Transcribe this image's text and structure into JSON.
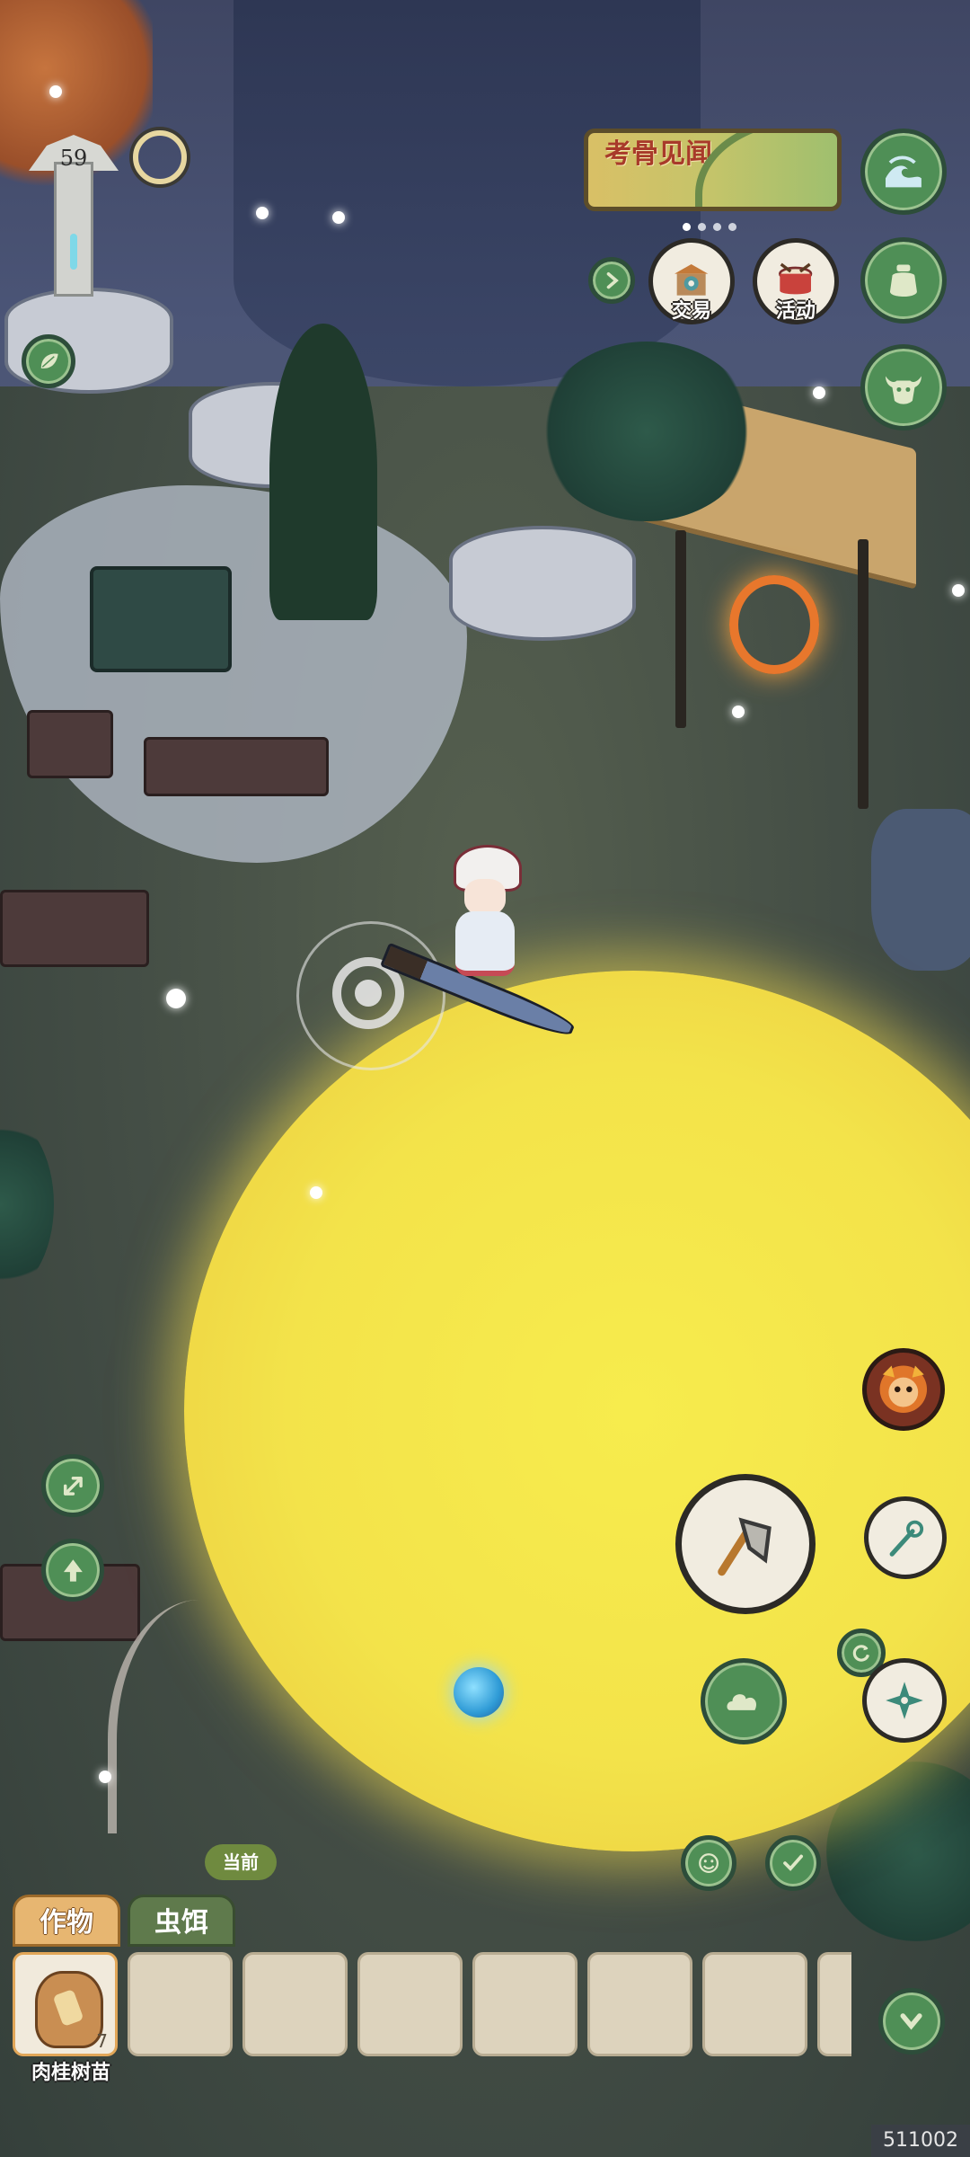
{
  "player_level": "59",
  "banner": {
    "title": "考骨见闻"
  },
  "shortcuts": {
    "trade_label": "交易",
    "event_label": "活动"
  },
  "inventory": {
    "current_tag": "当前",
    "tabs": [
      "作物",
      "虫饵"
    ],
    "slots": [
      {
        "item": "肉桂树苗",
        "count": "7"
      },
      {
        "item": "",
        "count": ""
      },
      {
        "item": "",
        "count": ""
      },
      {
        "item": "",
        "count": ""
      },
      {
        "item": "",
        "count": ""
      },
      {
        "item": "",
        "count": ""
      },
      {
        "item": "",
        "count": ""
      },
      {
        "item": "",
        "count": ""
      }
    ]
  },
  "build_id": "511002",
  "icons": {
    "top_right": [
      "wave-icon",
      "jar-icon",
      "ox-head-icon"
    ],
    "side_right": [
      "monkey-avatar-icon",
      "axe-icon",
      "spear-icon",
      "cloud-icon",
      "refresh-icon",
      "shuriken-icon"
    ],
    "bottom_right": [
      "emote-icon",
      "checklist-icon",
      "collapse-icon"
    ],
    "left": [
      "leaf-icon",
      "expand-icon",
      "tree-icon"
    ]
  },
  "colors": {
    "glow": "#f3e34a",
    "button_green": "#4f8f56",
    "tab_active": "#e7b671"
  }
}
